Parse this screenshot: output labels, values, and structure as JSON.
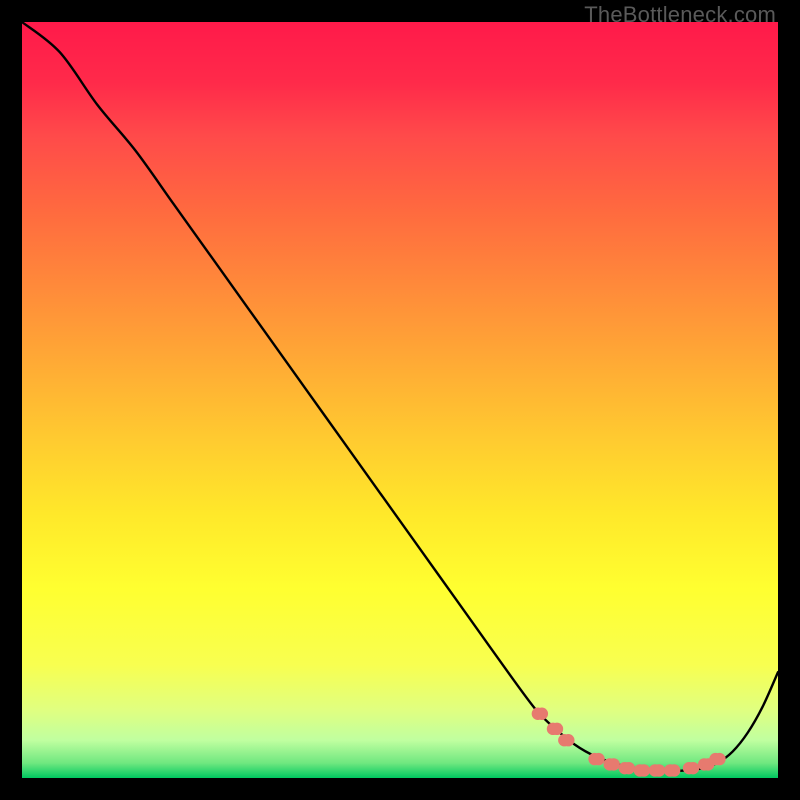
{
  "watermark": "TheBottleneck.com",
  "chart_data": {
    "type": "line",
    "title": "",
    "xlabel": "",
    "ylabel": "",
    "xlim": [
      0,
      100
    ],
    "ylim": [
      0,
      100
    ],
    "series": [
      {
        "name": "bottleneck-curve",
        "x": [
          0,
          5,
          10,
          15,
          20,
          25,
          30,
          35,
          40,
          45,
          50,
          55,
          60,
          65,
          68,
          70,
          73,
          76,
          80,
          84,
          88,
          90,
          92,
          94,
          96,
          98,
          100
        ],
        "y": [
          100,
          96,
          89,
          83,
          76,
          69,
          62,
          55,
          48,
          41,
          34,
          27,
          20,
          13,
          9,
          7,
          4.5,
          2.8,
          1.5,
          1.0,
          1.0,
          1.3,
          2.0,
          3.5,
          6.0,
          9.5,
          14
        ],
        "color": "#000000"
      }
    ],
    "markers": {
      "name": "highlight-dots",
      "color": "#e77a6f",
      "points": [
        {
          "x": 68.5,
          "y": 8.5
        },
        {
          "x": 70.5,
          "y": 6.5
        },
        {
          "x": 72.0,
          "y": 5.0
        },
        {
          "x": 76.0,
          "y": 2.5
        },
        {
          "x": 78.0,
          "y": 1.8
        },
        {
          "x": 80.0,
          "y": 1.3
        },
        {
          "x": 82.0,
          "y": 1.0
        },
        {
          "x": 84.0,
          "y": 1.0
        },
        {
          "x": 86.0,
          "y": 1.0
        },
        {
          "x": 88.5,
          "y": 1.3
        },
        {
          "x": 90.5,
          "y": 1.8
        },
        {
          "x": 92.0,
          "y": 2.5
        }
      ]
    },
    "background_gradient": {
      "top": "#ff1a4a",
      "mid": "#ffff30",
      "bottom": "#00c860"
    }
  }
}
